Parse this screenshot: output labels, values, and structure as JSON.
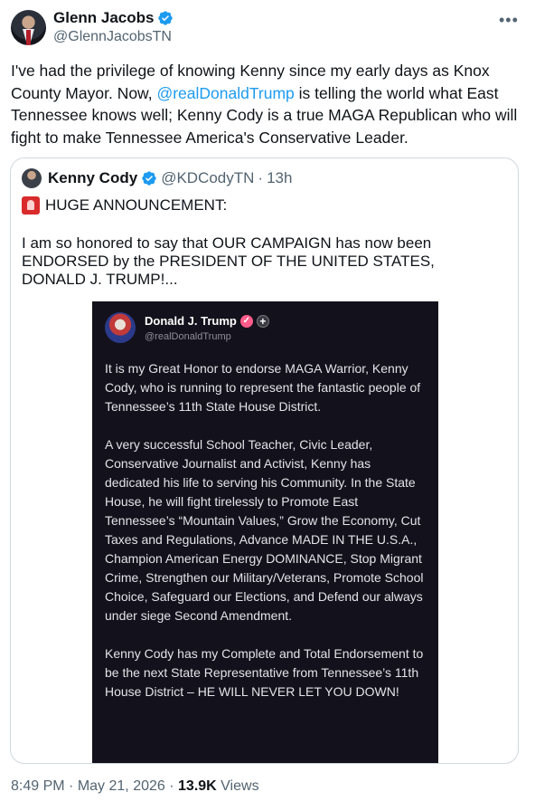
{
  "author": {
    "name": "Glenn Jacobs",
    "handle": "@GlennJacobsTN"
  },
  "tweet": {
    "text_before": "I've had the privilege of knowing Kenny since my early days as Knox County Mayor. Now, ",
    "mention": "@realDonaldTrump",
    "text_after": " is telling the world what East Tennessee knows well; Kenny Cody is a true MAGA Republican who will fight to make Tennessee America's Conservative Leader."
  },
  "quote": {
    "name": "Kenny Cody",
    "handle": "@KDCodyTN",
    "separator": "·",
    "time": "13h",
    "headline": "HUGE ANNOUNCEMENT:",
    "body": "I am so honored to say that OUR CAMPAIGN has now been ENDORSED by the PRESIDENT OF THE UNITED STATES, DONALD J. TRUMP!...",
    "embed": {
      "name": "Donald J. Trump",
      "handle": "@realDonaldTrump",
      "paragraphs": [
        "It is my Great Honor to endorse MAGA Warrior, Kenny Cody, who is running to represent the fantastic people of Tennessee’s 11th State House District.",
        "A very successful School Teacher, Civic Leader, Conservative Journalist and Activist, Kenny has dedicated his life to serving his Community. In the State House, he will fight tirelessly to Promote East Tennessee’s “Mountain Values,” Grow the Economy, Cut Taxes and Regulations, Advance MADE IN THE U.S.A., Champion American Energy DOMINANCE, Stop Migrant Crime, Strengthen our Military/Veterans, Promote School Choice, Safeguard our Elections, and Defend our always under siege Second Amendment.",
        "Kenny Cody has my Complete and Total Endorsement to be the next State Representative from Tennessee’s 11th House District – HE WILL NEVER LET YOU DOWN!"
      ]
    }
  },
  "footer": {
    "time": "8:49 PM",
    "dot1": "·",
    "date": "May 21, 2026",
    "dot2": "·",
    "views_count": "13.9K",
    "views_label": "Views"
  },
  "colors": {
    "accent": "#1d9bf0",
    "muted": "#536471",
    "embed_bg": "#13111b"
  },
  "icons": [
    "verified-badge-icon",
    "more-icon",
    "siren-emoji-icon",
    "pink-verified-icon",
    "plus-badge-icon"
  ]
}
